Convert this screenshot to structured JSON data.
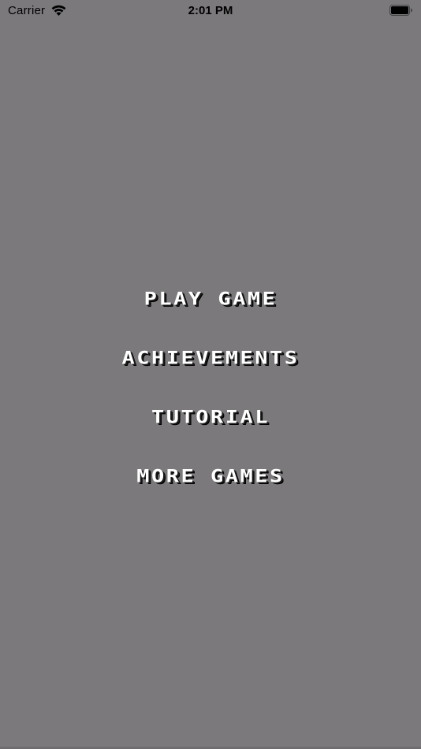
{
  "status_bar": {
    "carrier": "Carrier",
    "time": "2:01 PM",
    "wifi_icon": "wifi-icon",
    "battery_icon": "battery-icon"
  },
  "colors": {
    "background": "#7b797c",
    "menu_text": "#ffffff",
    "menu_shadow": "#000000"
  },
  "menu": {
    "items": [
      {
        "label": "PLAY GAME"
      },
      {
        "label": "ACHIEVEMENTS"
      },
      {
        "label": "TUTORIAL"
      },
      {
        "label": "MORE GAMES"
      }
    ]
  }
}
